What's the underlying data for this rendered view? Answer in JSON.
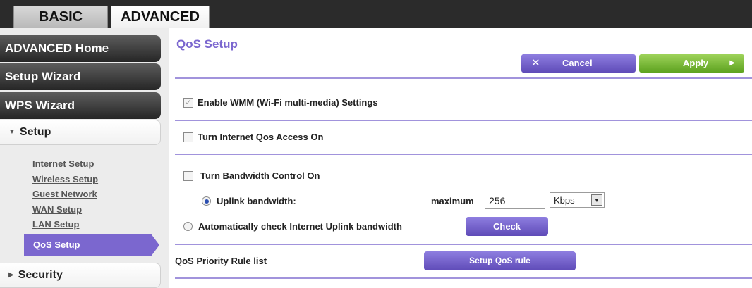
{
  "tabs": {
    "basic": "BASIC",
    "advanced": "ADVANCED"
  },
  "sidebar": {
    "home": "ADVANCED Home",
    "setup_wizard": "Setup Wizard",
    "wps_wizard": "WPS Wizard",
    "setup_section": "Setup",
    "setup_items": [
      "Internet Setup",
      "Wireless Setup",
      "Guest Network",
      "WAN Setup",
      "LAN Setup"
    ],
    "active_item": "QoS Setup",
    "security_section": "Security"
  },
  "main": {
    "title": "QoS Setup",
    "cancel_label": "Cancel",
    "apply_label": "Apply",
    "wmm_label": "Enable WMM (Wi-Fi multi-media) Settings",
    "wmm_checked": true,
    "qos_access_label": "Turn Internet Qos Access On",
    "bandwidth_label": "Turn Bandwidth Control On",
    "uplink_label": "Uplink bandwidth:",
    "maximum_label": "maximum",
    "maximum_value": "256",
    "unit_value": "Kbps",
    "auto_check_label": "Automatically check Internet Uplink bandwidth",
    "check_label": "Check",
    "rule_list_label": "QoS Priority Rule list",
    "rule_button_label": "Setup QoS rule"
  },
  "colors": {
    "accent": "#7b67cf",
    "apply_green": "#7bbf3a",
    "sidebar_dark": "#333333"
  }
}
